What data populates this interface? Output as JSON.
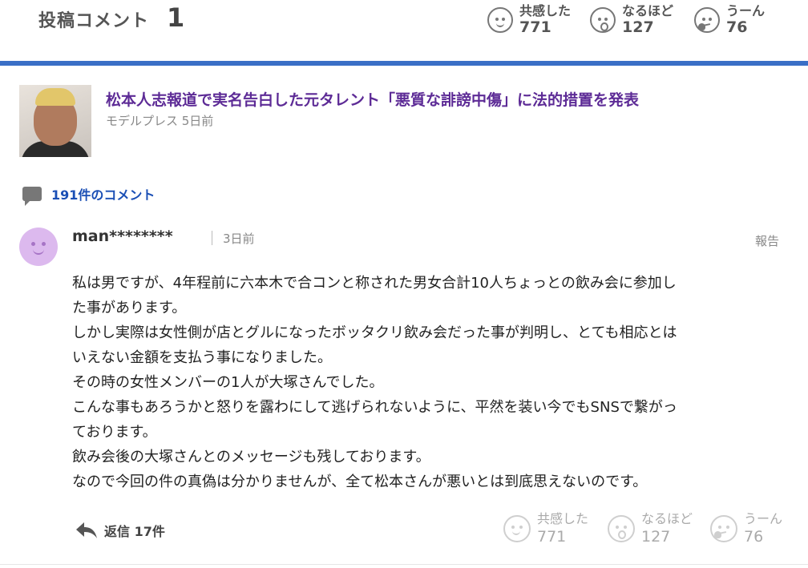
{
  "header": {
    "title": "投稿コメント",
    "count": "1",
    "reactions": [
      {
        "label": "共感した",
        "count": "771",
        "icon": "smile-face-icon"
      },
      {
        "label": "なるほど",
        "count": "127",
        "icon": "surprised-face-icon"
      },
      {
        "label": "うーん",
        "count": "76",
        "icon": "thinking-face-icon"
      }
    ],
    "accent_color": "#3a6fc6"
  },
  "article": {
    "headline": "松本人志報道で実名告白した元タレント「悪質な誹謗中傷」に法的措置を発表",
    "source": "モデルプレス 5日前"
  },
  "comments_link": "191件のコメント",
  "comment": {
    "user": "man********",
    "time": "3日前",
    "report": "報告",
    "lines": [
      "私は男ですが、4年程前に六本木で合コンと称された男女合計10人ちょっとの飲み会に参加し",
      "た事があります。",
      "しかし実際は女性側が店とグルになったボッタクリ飲み会だった事が判明し、とても相応とは",
      "いえない金額を支払う事になりました。",
      "その時の女性メンバーの1人が大塚さんでした。",
      "こんな事もあろうかと怒りを露わにして逃げられないように、平然を装い今でもSNSで繋がっ",
      "ております。",
      "飲み会後の大塚さんとのメッセージも残しております。",
      "なので今回の件の真偽は分かりませんが、全て松本さんが悪いとは到底思えないのです。"
    ],
    "reply": "返信 17件",
    "reactions": [
      {
        "label": "共感した",
        "count": "771"
      },
      {
        "label": "なるほど",
        "count": "127"
      },
      {
        "label": "うーん",
        "count": "76"
      }
    ]
  }
}
